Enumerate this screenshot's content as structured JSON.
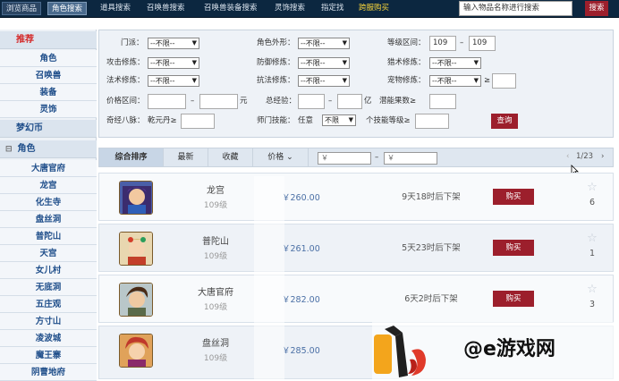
{
  "topnav": {
    "tabs": [
      {
        "label": "浏览商品"
      },
      {
        "label": "角色搜索"
      },
      {
        "label": "道具搜索"
      },
      {
        "label": "召唤兽搜索"
      },
      {
        "label": "召唤兽装备搜索"
      },
      {
        "label": "灵饰搜索"
      },
      {
        "label": "指定找"
      },
      {
        "label": "跨服购买"
      }
    ],
    "search_placeholder": "输入物品名称进行搜索",
    "search_button": "搜索"
  },
  "sidebar": {
    "recommend_header": "推荐",
    "recommend_items": [
      "角色",
      "召唤兽",
      "装备",
      "灵饰"
    ],
    "currency_header": "梦幻币",
    "role_toggle": "⊟",
    "role_header": "角色",
    "schools": [
      "大唐官府",
      "龙宫",
      "化生寺",
      "盘丝洞",
      "普陀山",
      "天宫",
      "女儿村",
      "无底洞",
      "五庄观",
      "方寸山",
      "凌波城",
      "魔王寨",
      "阴曹地府"
    ]
  },
  "filters": {
    "school_label": "门派：",
    "school_value": "--不限--",
    "look_label": "角色外形：",
    "look_value": "--不限--",
    "level_label": "等级区间：",
    "level_min": "109",
    "level_dash": "–",
    "level_max": "109",
    "atk_label": "攻击修炼：",
    "atk_value": "--不限--",
    "def_label": "防御修炼：",
    "def_value": "--不限--",
    "hunt_label": "猎术修炼：",
    "hunt_value": "--不限--",
    "mag_label": "法术修炼：",
    "mag_value": "--不限--",
    "res_label": "抗法修炼：",
    "res_value": "--不限--",
    "pet_label": "宠物修炼：",
    "pet_value": "--不限--",
    "pet_ge": "≥",
    "price_label": "价格区间：",
    "price_dash": "–",
    "price_unit": "元",
    "exp_label": "总经验：",
    "exp_dash": "–",
    "exp_unit": "亿",
    "potential_label": "潜能果数≥",
    "qijing_label": "奇经八脉：",
    "qijing_sub": "乾元丹≥",
    "master_label": "师门技能：",
    "master_any": "任意",
    "master_value": "不限",
    "skill_level_label": "个技能等级≥",
    "query_button": "查询"
  },
  "sortbar": {
    "tabs": [
      "综合排序",
      "最新",
      "收藏",
      "价格"
    ],
    "price_arrow": "⌄",
    "price_from": "￥",
    "price_dash": "–",
    "price_to": "￥",
    "prev": "‹",
    "page": "1/23",
    "next": "›"
  },
  "listings": [
    {
      "school": "龙宫",
      "level": "109级",
      "price": "￥260.00",
      "time_left": "9天18时后下架",
      "buy": "购买",
      "favorites": "6"
    },
    {
      "school": "普陀山",
      "level": "109级",
      "price": "￥261.00",
      "time_left": "5天23时后下架",
      "buy": "购买",
      "favorites": "1"
    },
    {
      "school": "大唐官府",
      "level": "109级",
      "price": "￥282.00",
      "time_left": "6天2时后下架",
      "buy": "购买",
      "favorites": "3"
    },
    {
      "school": "盘丝洞",
      "level": "109级",
      "price": "￥285.00",
      "time_left": "",
      "buy": "",
      "favorites": ""
    }
  ],
  "watermark": {
    "text": "@e游戏网"
  }
}
